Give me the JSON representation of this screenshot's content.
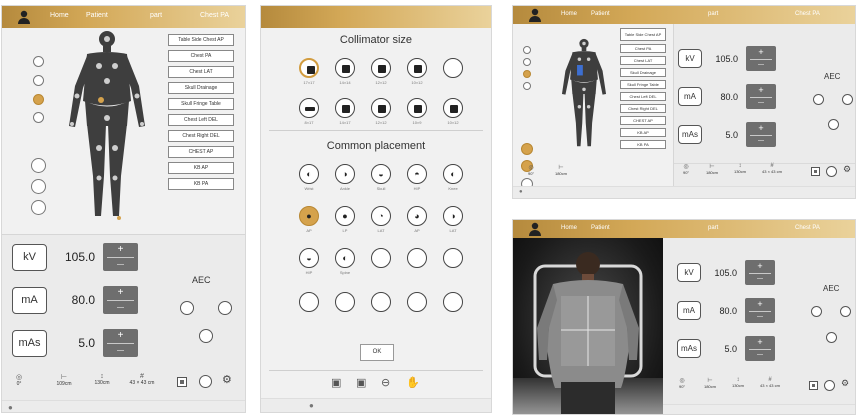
{
  "header": {
    "home": "Home",
    "patient": "Patient",
    "part": "part",
    "position": "Chest PA"
  },
  "protocols": [
    "Table Side Chest AP",
    "Chest PA",
    "Chest LAT",
    "Skull Drainage",
    "Skull Fringe Table",
    "Chest Left DEL",
    "Chest Right DEL",
    "CHEST AP",
    "KB AP",
    "KB PA"
  ],
  "parameters": [
    {
      "label": "kV",
      "value": "105.0"
    },
    {
      "label": "mA",
      "value": "80.0"
    },
    {
      "label": "mAs",
      "value": "5.0"
    }
  ],
  "aec_label": "AEC",
  "stepper": {
    "plus": "+",
    "minus": "—"
  },
  "status": {
    "angle": "0°",
    "sid": "109cm",
    "height": "130cm",
    "field": "43 × 43 cm"
  },
  "status_right": {
    "angle": "90°",
    "sid": "180cm",
    "height": "130cm",
    "field": "43 × 43 cm"
  },
  "collimator": {
    "title": "Collimator size",
    "sizes": [
      "17×17",
      "14×14",
      "12×12",
      "10×12",
      "",
      "8×17",
      "14×17",
      "12×12",
      "10×9",
      "10×12"
    ],
    "placement_title": "Common placement",
    "placements": [
      "Wrist",
      "Ankle",
      "Skull",
      "HIP",
      "Knee",
      "AP",
      "LP",
      "LAT",
      "AP",
      "LAT",
      "HIP",
      "Spine",
      "",
      "",
      "",
      "",
      "",
      "",
      "",
      ""
    ],
    "ok_label": "OK"
  },
  "icons": {
    "user": "user-icon",
    "settings": "gear-icon",
    "zoom": "zoom-icon",
    "hand": "hand-icon"
  },
  "colors": {
    "gold": "#d5a24c",
    "header_start": "#b58a3d",
    "header_end": "#ead29b",
    "stepper": "#6e6e6e"
  }
}
